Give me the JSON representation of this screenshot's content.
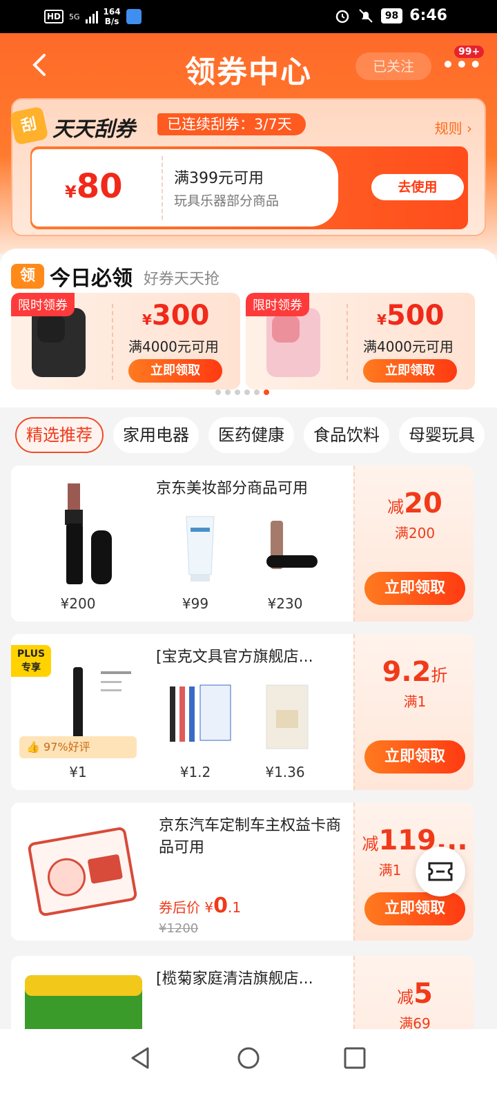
{
  "status_bar": {
    "hd": "HD",
    "network": "5G",
    "speed_value": "164",
    "speed_unit": "B/s",
    "battery": "98",
    "time": "6:46"
  },
  "header": {
    "title": "领券中心",
    "follow_label": "已关注",
    "more_label": "•••",
    "notify_badge": "99+"
  },
  "scratch": {
    "logo_text": "刮",
    "title": "天天刮券",
    "streak": "已连续刮券：3/7天",
    "rules_label": "规则 ›",
    "coupon": {
      "currency": "¥",
      "amount": "80",
      "condition": "满399元可用",
      "scope": "玩具乐器部分商品",
      "button": "去使用"
    }
  },
  "today": {
    "logo_text": "领",
    "title": "今日必领",
    "subtitle": "好券天天抢",
    "deals": [
      {
        "tag": "限时领券",
        "currency": "¥",
        "amount": "300",
        "condition": "满4000元可用",
        "button": "立即领取",
        "phone_color": "#2b2b2b"
      },
      {
        "tag": "限时领券",
        "currency": "¥",
        "amount": "500",
        "condition": "满4000元可用",
        "button": "立即领取",
        "phone_color": "#f6c6cf"
      }
    ]
  },
  "tabs": [
    "精选推荐",
    "家用电器",
    "医药健康",
    "食品饮料",
    "母婴玩具"
  ],
  "cards": [
    {
      "title": "京东美妆部分商品可用",
      "prices": [
        "¥200",
        "¥99",
        "¥230"
      ],
      "discount_prefix": "减",
      "discount": "20",
      "condition": "满200",
      "button": "立即领取"
    },
    {
      "title": "[宝克文具官方旗舰店...",
      "plus_line1": "PLUS",
      "plus_line2": "专享",
      "rating": "97%好评",
      "prices": [
        "¥1",
        "¥1.2",
        "¥1.36"
      ],
      "discount": "9.2",
      "discount_suffix": "折",
      "condition": "满1",
      "button": "立即领取"
    },
    {
      "title": "京东汽车定制车主权益卡商品可用",
      "after_label": "券后价",
      "after_currency": "¥",
      "after_int": "0",
      "after_dec": ".1",
      "original": "¥1200",
      "discount_prefix": "减",
      "discount": "119...",
      "condition": "满1",
      "button": "立即领取"
    },
    {
      "title": "[榄菊家庭清洁旗舰店...",
      "discount_prefix": "减",
      "discount": "5",
      "condition": "满69"
    }
  ],
  "colors": {
    "brand_orange": "#ff6a2a",
    "price_red": "#f02a1a"
  }
}
